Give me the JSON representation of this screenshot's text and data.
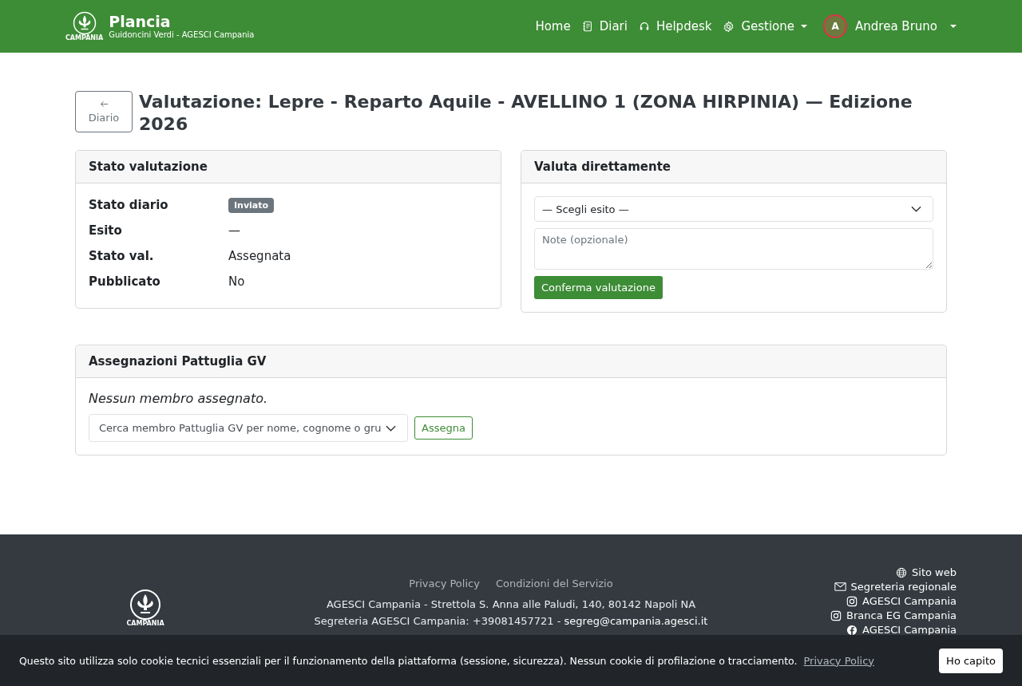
{
  "navbar": {
    "brand": "Plancia",
    "subtitle": "Guidoncini Verdi - AGESCI Campania",
    "logo_caption": "CAMPANIA",
    "items": [
      {
        "label": "Home",
        "dropdown": false
      },
      {
        "label": "Diari",
        "dropdown": false
      },
      {
        "label": "Helpdesk",
        "dropdown": false
      },
      {
        "label": "Gestione",
        "dropdown": true
      }
    ],
    "user": {
      "initial": "A",
      "name": "Andrea Bruno"
    }
  },
  "back_button": "Diario",
  "title": "Valutazione: Lepre - Reparto Aquile - AVELLINO 1 (ZONA HIRPINIA) — Edizione 2026",
  "status_card": {
    "title": "Stato valutazione",
    "rows": [
      {
        "label": "Stato diario",
        "value": "Inviato",
        "kind": "badge"
      },
      {
        "label": "Esito",
        "value": "—",
        "kind": "text"
      },
      {
        "label": "Stato val.",
        "value": "Assegnata",
        "kind": "text"
      },
      {
        "label": "Pubblicato",
        "value": "No",
        "kind": "text"
      }
    ]
  },
  "direct_card": {
    "title": "Valuta direttamente",
    "select": "— Scegli esito —",
    "notes": {
      "placeholder": "Note (opzionale)"
    },
    "button": "Conferma valutazione"
  },
  "assign_card": {
    "title": "Assegnazioni Pattuglia GV",
    "empty": "Nessun membro assegnato.",
    "search": {
      "placeholder": "Cerca membro Pattuglia GV per nome, cognome o gru"
    },
    "button": "Assegna"
  },
  "footer": {
    "logo_caption": "CAMPANIA",
    "links": [
      "Privacy Policy",
      "Condizioni del Servizio"
    ],
    "address": "AGESCI Campania - Strettola S. Anna alle Paludi, 140, 80142 Napoli NA",
    "contact": "Segreteria AGESCI Campania: +39081457721 - ",
    "email": "segreg@campania.agesci.it",
    "social": [
      "Sito web",
      "Segreteria regionale",
      "AGESCI Campania",
      "Branca EG Campania",
      "AGESCI Campania"
    ]
  },
  "cookie_bar": {
    "text": "Questo sito utilizza solo cookie tecnici essenziali per il funzionamento della piattaforma (sessione, sicurezza). Nessun cookie di profilazione o tracciamento.",
    "link": "Privacy Policy",
    "button": "Ho capito"
  }
}
